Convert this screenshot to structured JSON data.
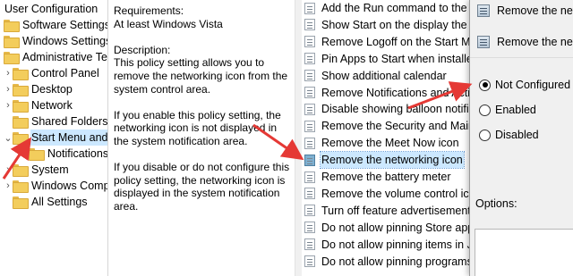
{
  "tree": {
    "items": [
      {
        "label": "User Configuration",
        "expander": "",
        "indent": 0,
        "selected": false
      },
      {
        "label": "Software Settings",
        "expander": "",
        "indent": 1,
        "selected": false
      },
      {
        "label": "Windows Settings",
        "expander": "",
        "indent": 1,
        "selected": false
      },
      {
        "label": "Administrative Templates",
        "expander": "",
        "indent": 1,
        "selected": false
      },
      {
        "label": "Control Panel",
        "expander": "›",
        "indent": 2,
        "selected": false
      },
      {
        "label": "Desktop",
        "expander": "›",
        "indent": 2,
        "selected": false
      },
      {
        "label": "Network",
        "expander": "›",
        "indent": 2,
        "selected": false
      },
      {
        "label": "Shared Folders",
        "expander": "",
        "indent": 2,
        "selected": false
      },
      {
        "label": "Start Menu and Taskbar",
        "expander": "⌄",
        "indent": 2,
        "selected": true
      },
      {
        "label": "Notifications",
        "expander": "",
        "indent": 3,
        "selected": false
      },
      {
        "label": "System",
        "expander": "›",
        "indent": 2,
        "selected": false
      },
      {
        "label": "Windows Components",
        "expander": "›",
        "indent": 2,
        "selected": false
      },
      {
        "label": "All Settings",
        "expander": "",
        "indent": 2,
        "selected": false
      }
    ]
  },
  "description": {
    "requirements_label": "Requirements:",
    "requirements_value": "At least Windows Vista",
    "description_label": "Description:",
    "para1": "This policy setting allows you to remove the networking icon from the system control area.",
    "para2": "If you enable this policy setting, the networking icon is not displayed in the system notification area.",
    "para3": "If you disable or do not configure this policy setting, the networking icon is displayed in the system notification area."
  },
  "settings": {
    "items": [
      {
        "label": "Add the Run command to the Start Menu",
        "selected": false
      },
      {
        "label": "Show Start on the display the user is using",
        "selected": false
      },
      {
        "label": "Remove Logoff on the Start Menu",
        "selected": false
      },
      {
        "label": "Pin Apps to Start when installed",
        "selected": false
      },
      {
        "label": "Show additional calendar",
        "selected": false
      },
      {
        "label": "Remove Notifications and Action Center",
        "selected": false
      },
      {
        "label": "Disable showing balloon notifications",
        "selected": false
      },
      {
        "label": "Remove the Security and Maintenance icon",
        "selected": false
      },
      {
        "label": "Remove the Meet Now icon",
        "selected": false
      },
      {
        "label": "Remove the networking icon",
        "selected": true
      },
      {
        "label": "Remove the battery meter",
        "selected": false
      },
      {
        "label": "Remove the volume control icon",
        "selected": false
      },
      {
        "label": "Turn off feature advertisement balloon notifications",
        "selected": false
      },
      {
        "label": "Do not allow pinning Store app to the Taskbar",
        "selected": false
      },
      {
        "label": "Do not allow pinning items in Jump Lists",
        "selected": false
      },
      {
        "label": "Do not allow pinning programs to the Taskbar",
        "selected": false
      }
    ]
  },
  "dialog": {
    "title": "Remove the networking icon",
    "header": "Remove the networking icon",
    "options": [
      {
        "label": "Not Configured",
        "checked": true
      },
      {
        "label": "Enabled",
        "checked": false
      },
      {
        "label": "Disabled",
        "checked": false
      }
    ],
    "options_label": "Options:"
  },
  "colors": {
    "annotation_arrow": "#e53935",
    "selection": "#cce8ff",
    "folder": "#f3cd5c"
  }
}
